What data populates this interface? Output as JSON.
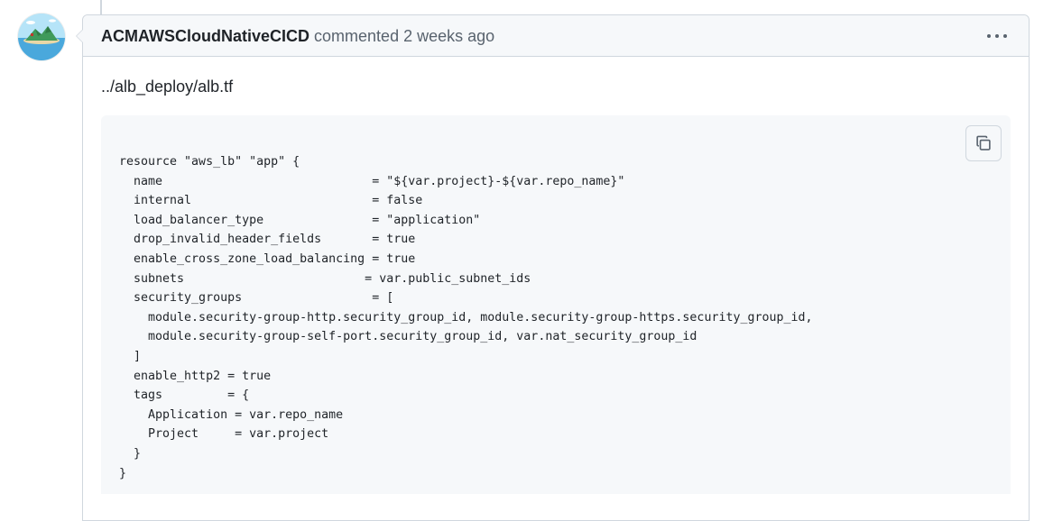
{
  "comment": {
    "author": "ACMAWSCloudNativeCICD",
    "action": "commented",
    "timestamp": "2 weeks ago",
    "file_path": "../alb_deploy/alb.tf",
    "code": "resource \"aws_lb\" \"app\" {\n  name                             = \"${var.project}-${var.repo_name}\"\n  internal                         = false\n  load_balancer_type               = \"application\"\n  drop_invalid_header_fields       = true\n  enable_cross_zone_load_balancing = true\n  subnets                         = var.public_subnet_ids\n  security_groups                  = [\n    module.security-group-http.security_group_id, module.security-group-https.security_group_id,\n    module.security-group-self-port.security_group_id, var.nat_security_group_id\n  ]\n  enable_http2 = true\n  tags         = {\n    Application = var.repo_name\n    Project     = var.project\n  }\n}"
  },
  "icons": {
    "more_options": "kebab-horizontal-icon",
    "copy": "copy-icon"
  }
}
